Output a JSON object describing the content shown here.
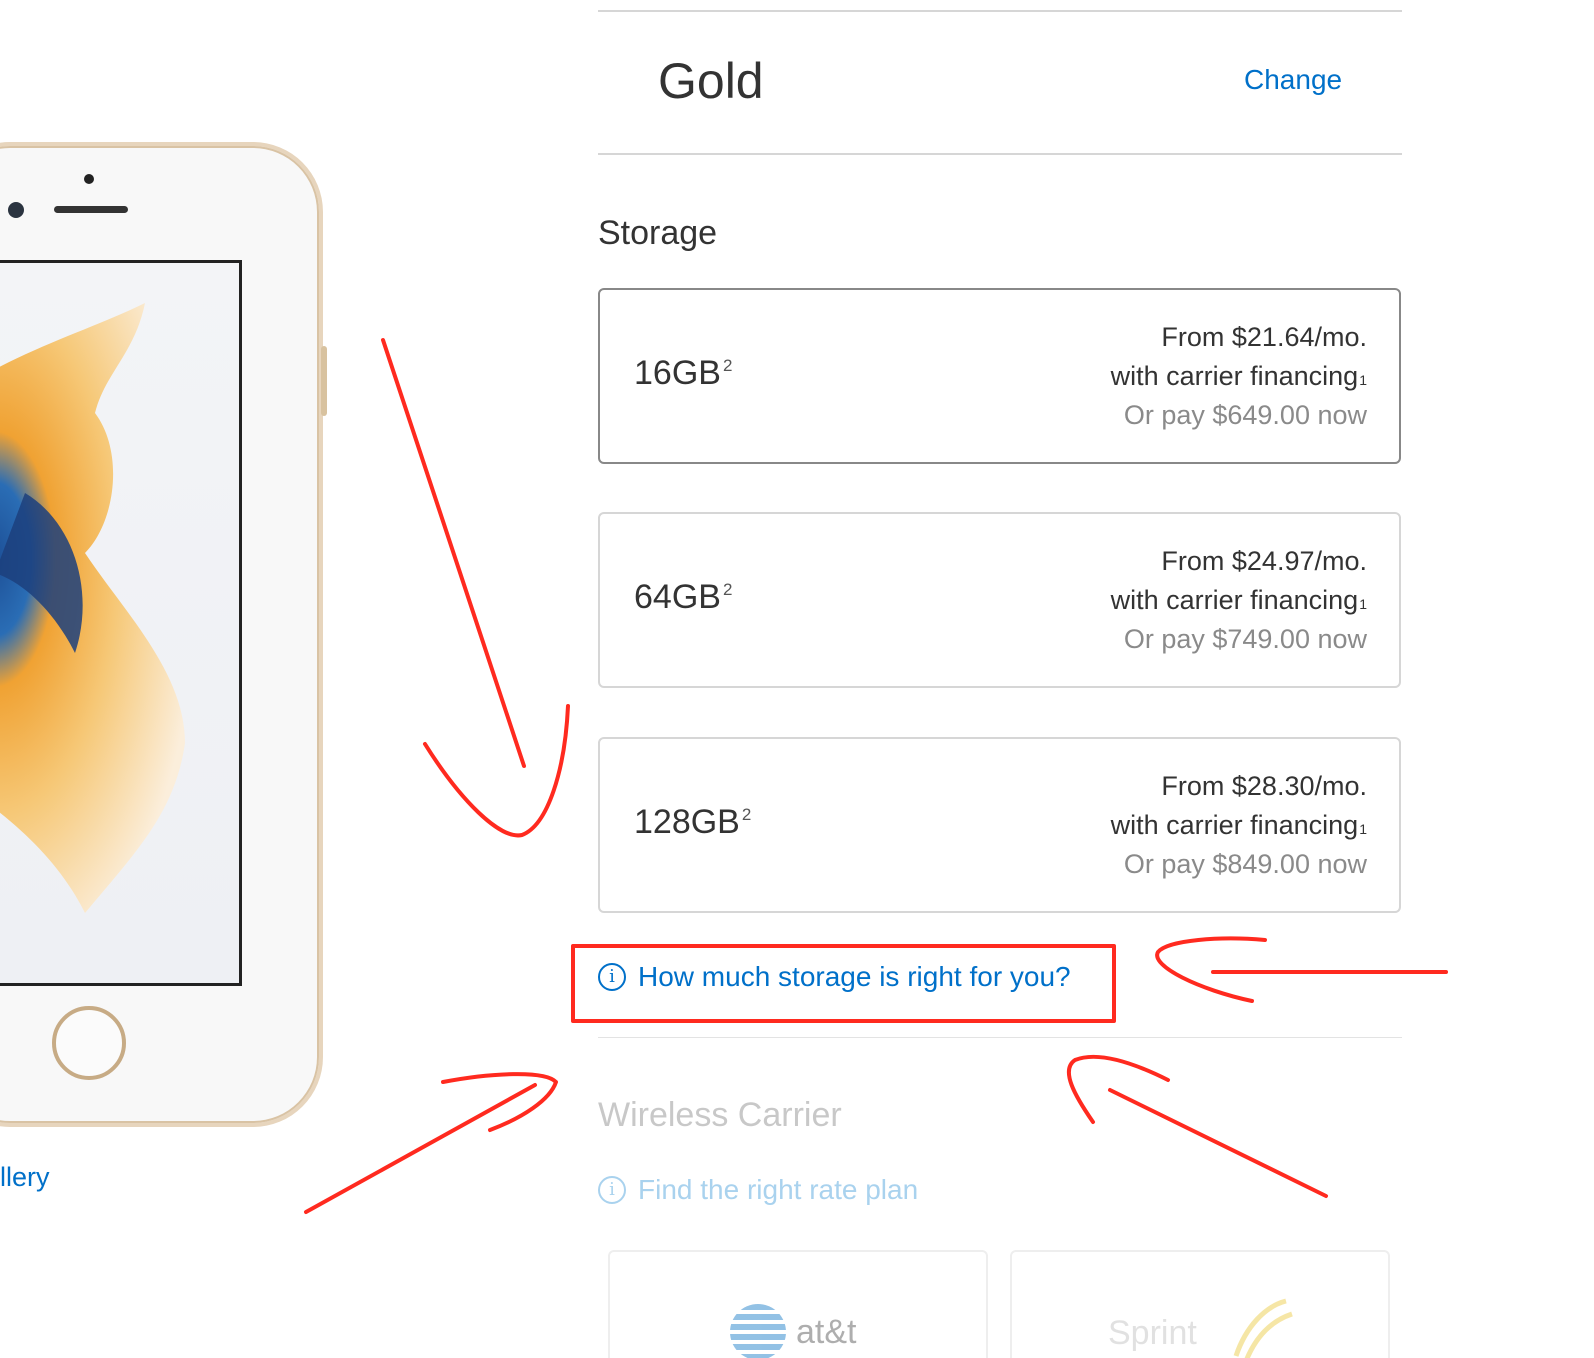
{
  "color": {
    "value": "Gold",
    "change_label": "Change"
  },
  "gallery": {
    "link_label": "llery"
  },
  "storage": {
    "heading": "Storage",
    "options": [
      {
        "size": "16GB",
        "footnote": "2",
        "monthly": "From $21.64/mo.",
        "financing": "with carrier financing",
        "financing_note": "1",
        "pay_now": "Or pay $649.00 now",
        "selected": true
      },
      {
        "size": "64GB",
        "footnote": "2",
        "monthly": "From $24.97/mo.",
        "financing": "with carrier financing",
        "financing_note": "1",
        "pay_now": "Or pay $749.00 now",
        "selected": false
      },
      {
        "size": "128GB",
        "footnote": "2",
        "monthly": "From $28.30/mo.",
        "financing": "with carrier financing",
        "financing_note": "1",
        "pay_now": "Or pay $849.00 now",
        "selected": false
      }
    ],
    "help_link": "How much storage is right for you?"
  },
  "carrier": {
    "heading": "Wireless Carrier",
    "rate_link": "Find the right rate plan",
    "cards": [
      {
        "name": "at&t"
      },
      {
        "name": "Sprint"
      }
    ]
  },
  "colors": {
    "link": "#0070c9",
    "annotation": "#ff2a1f",
    "border": "#d6d6d6"
  },
  "icons": {
    "info": "info-circle-icon"
  }
}
